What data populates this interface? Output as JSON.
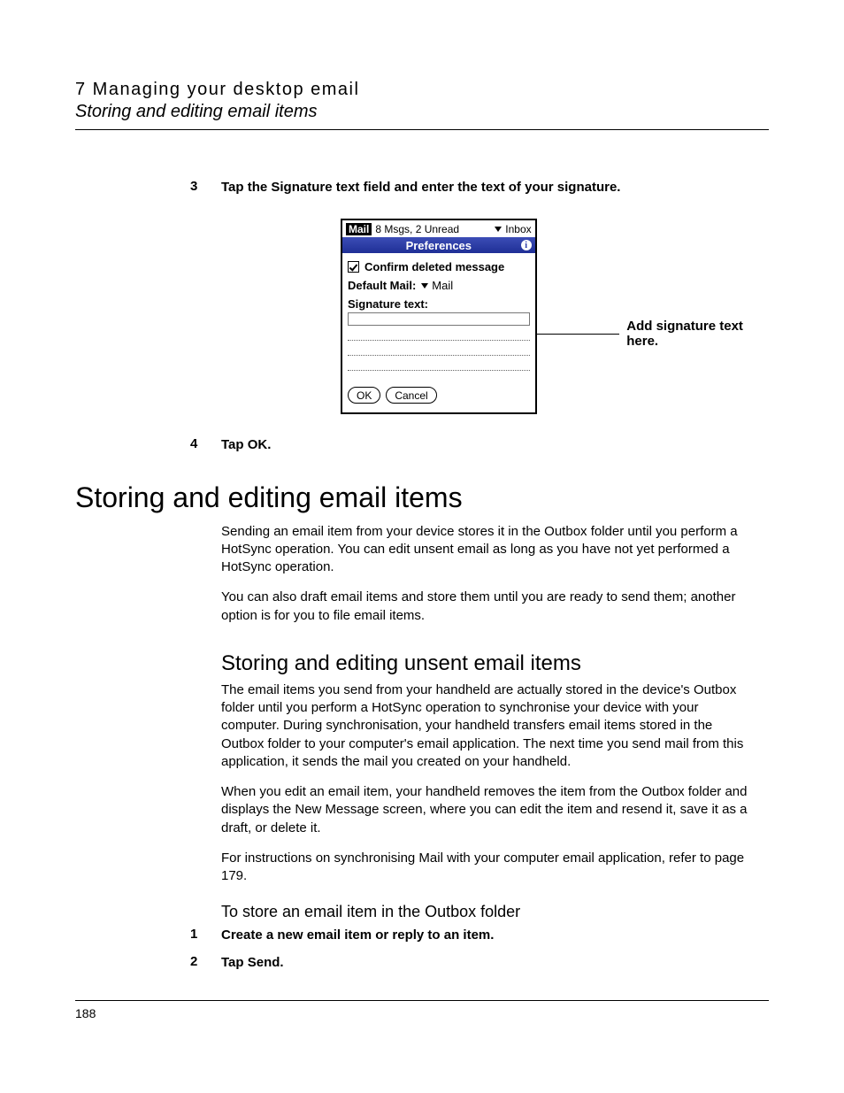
{
  "header": {
    "chapter": "7 Managing your desktop email",
    "section_italic": "Storing and editing email items"
  },
  "steps_top": [
    {
      "n": "3",
      "text": "Tap the Signature text field and enter the text of your signature."
    }
  ],
  "device": {
    "mail_tag": "Mail",
    "msg_count": "8 Msgs, 2 Unread",
    "folder": "Inbox",
    "pref_title": "Preferences",
    "info_glyph": "i",
    "confirm_label": "Confirm deleted message",
    "default_mail_label": "Default Mail:",
    "default_mail_value": "Mail",
    "sig_label": "Signature text:",
    "ok": "OK",
    "cancel": "Cancel"
  },
  "callout": "Add signature text here.",
  "steps_bottom": [
    {
      "n": "4",
      "text": "Tap OK."
    }
  ],
  "h1": "Storing and editing email items",
  "para1": "Sending an email item from your device stores it in the Outbox folder until you perform a HotSync operation. You can edit unsent email as long as you have not yet performed a HotSync operation.",
  "para2": "You can also draft email items and store them until you are ready to send them; another option is for you to file email items.",
  "h2": "Storing and editing unsent email items",
  "para3": "The email items you send from your handheld are actually stored in the device's Outbox folder until you perform a HotSync operation to synchronise your device with your computer. During synchronisation, your handheld transfers email items stored in the Outbox folder to your computer's email application. The next time you send mail from this application, it sends the mail you created on your handheld.",
  "para4": "When you edit an email item, your handheld removes the item from the Outbox folder and displays the New Message screen, where you can edit the item and resend it, save it as a draft, or delete it.",
  "para5": "For instructions on synchronising Mail with your computer email application, refer to page 179.",
  "h3": "To store an email item in the Outbox folder",
  "steps_h3": [
    {
      "n": "1",
      "text": "Create a new email item or reply to an item."
    },
    {
      "n": "2",
      "text": "Tap Send."
    }
  ],
  "page_number": "188"
}
